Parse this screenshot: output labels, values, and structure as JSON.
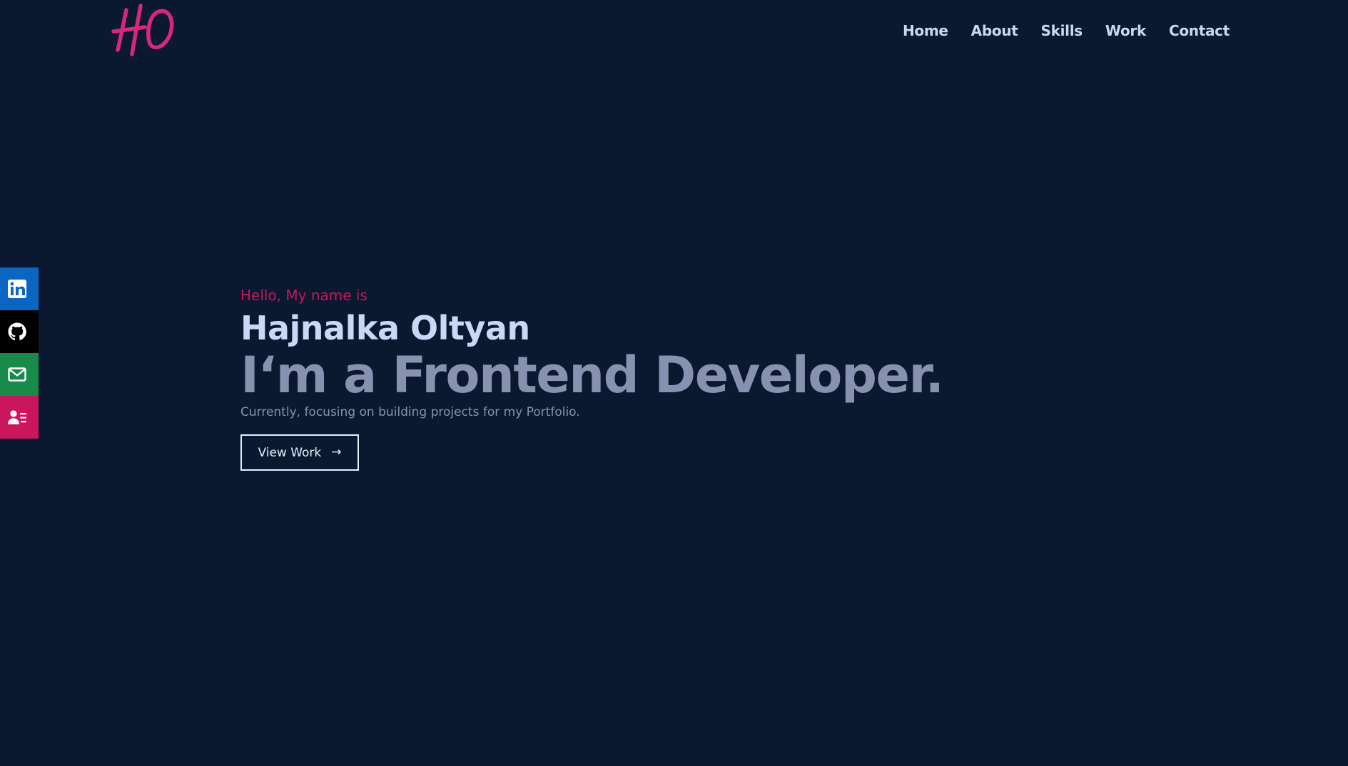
{
  "header": {
    "logo_text": "HO",
    "nav": [
      {
        "label": "Home"
      },
      {
        "label": "About"
      },
      {
        "label": "Skills"
      },
      {
        "label": "Work"
      },
      {
        "label": "Contact"
      }
    ]
  },
  "social": [
    {
      "icon": "linkedin-icon",
      "color": "#0a66c2"
    },
    {
      "icon": "github-icon",
      "color": "#000000"
    },
    {
      "icon": "mail-icon",
      "color": "#1a8a4a"
    },
    {
      "icon": "resume-icon",
      "color": "#c9165c"
    }
  ],
  "hero": {
    "greeting": "Hello, My name is",
    "name": "Hajnalka Oltyan",
    "role": "I‘m a Frontend Developer.",
    "description": "Currently, focusing on building projects for my Portfolio.",
    "cta_label": "View Work",
    "cta_arrow": "→"
  },
  "colors": {
    "background": "#0a192f",
    "accent": "#c9165c",
    "heading": "#ccd6f6",
    "muted": "#8892b0"
  }
}
